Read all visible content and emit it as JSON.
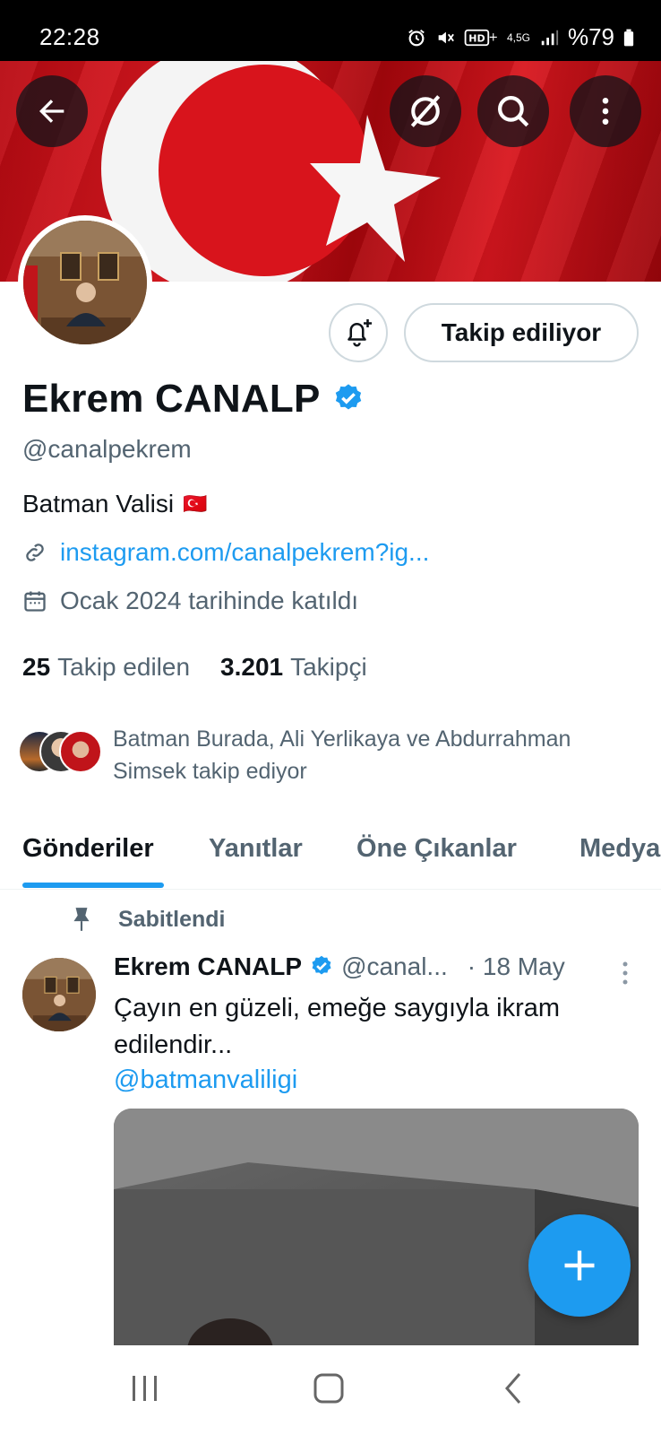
{
  "status_bar": {
    "time": "22:28",
    "network": "4,5G",
    "battery": "%79",
    "icons": [
      "alarm-icon",
      "mute-icon",
      "hd-plus-icon",
      "signal-icon",
      "battery-icon"
    ]
  },
  "header": {
    "back_icon": "arrow-left-icon",
    "grok_icon": "grok-icon",
    "search_icon": "search-icon",
    "more_icon": "more-vertical-icon",
    "banner": "turkish-flag-banner"
  },
  "profile": {
    "display_name": "Ekrem CANALP",
    "verified": true,
    "handle": "@canalpekrem",
    "bio": "Batman Valisi",
    "bio_emoji": "🇹🇷",
    "link": "instagram.com/canalpekrem?ig...",
    "joined": "Ocak 2024 tarihinde katıldı",
    "following_count": "25",
    "following_label": "Takip edilen",
    "followers_count": "3.201",
    "followers_label": "Takipçi",
    "followed_by_line1": "Batman Burada, Ali Yerlikaya ve Abdurrahman",
    "followed_by_line2": "Simsek takip ediyor",
    "follow_button": "Takip ediliyor"
  },
  "tabs": [
    {
      "label": "Gönderiler",
      "active": true
    },
    {
      "label": "Yanıtlar",
      "active": false
    },
    {
      "label": "Öne Çıkanlar",
      "active": false
    },
    {
      "label": "Medya",
      "active": false
    }
  ],
  "pinned_tweet": {
    "pinned_label": "Sabitlendi",
    "author": "Ekrem CANALP",
    "handle": "@canal...",
    "date": "· 18 May",
    "text": "Çayın en güzeli, emeğe saygıyla ikram edilendir...",
    "mention": "@batmanvaliligi"
  },
  "colors": {
    "accent": "#1d9bf0",
    "text": "#0f1419",
    "secondary_text": "#536471",
    "border": "#cfd9de",
    "banner_red": "#e11a22"
  }
}
